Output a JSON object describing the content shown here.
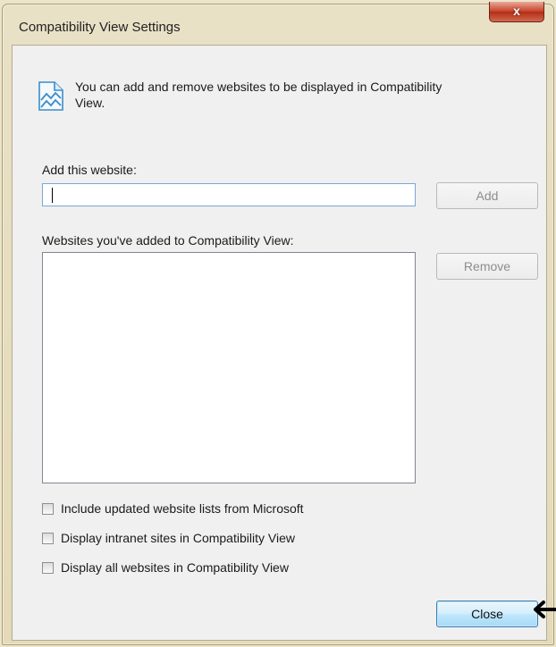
{
  "window": {
    "title": "Compatibility View Settings",
    "close_glyph": "x"
  },
  "intro": {
    "icon": "compatibility-view-icon",
    "text": "You can add and remove websites to be displayed in Compatibility View."
  },
  "add_site": {
    "label": "Add this website:",
    "value": "",
    "button_label": "Add"
  },
  "site_list": {
    "label": "Websites you've added to Compatibility View:",
    "items": [],
    "remove_label": "Remove"
  },
  "options": [
    {
      "label": "Include updated website lists from Microsoft",
      "checked": false
    },
    {
      "label": "Display intranet sites in Compatibility View",
      "checked": false
    },
    {
      "label": "Display all websites in Compatibility View",
      "checked": false
    }
  ],
  "footer": {
    "close_label": "Close"
  },
  "colors": {
    "accent": "#3c7fb1",
    "close_red": "#c9452c"
  }
}
